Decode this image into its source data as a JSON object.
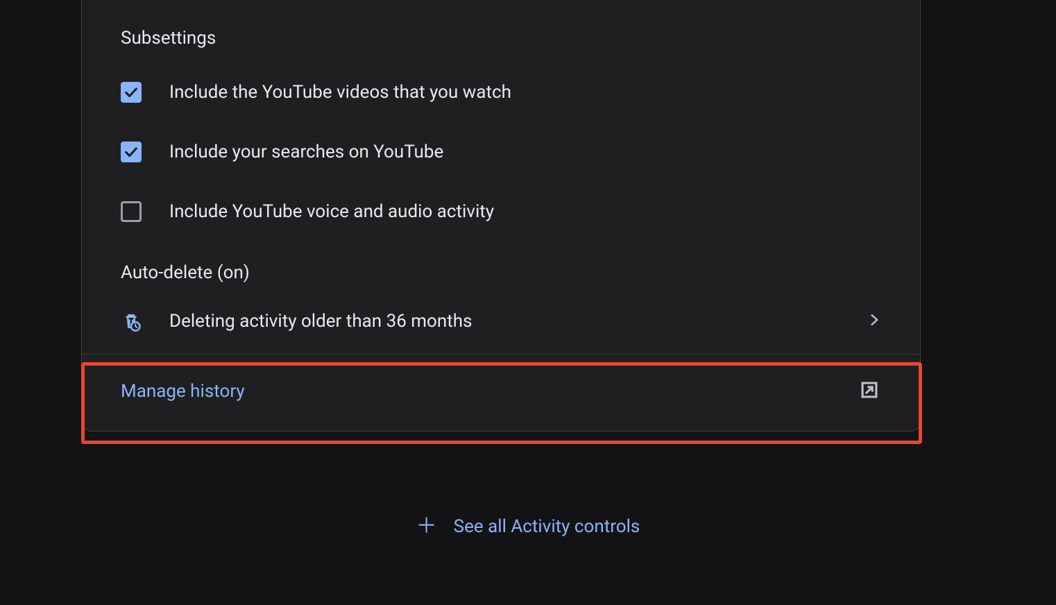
{
  "subsettings": {
    "title": "Subsettings",
    "items": [
      {
        "label": "Include the YouTube videos that you watch",
        "checked": true
      },
      {
        "label": "Include your searches on YouTube",
        "checked": true
      },
      {
        "label": "Include YouTube voice and audio activity",
        "checked": false
      }
    ]
  },
  "auto_delete": {
    "title": "Auto-delete (on)",
    "description": "Deleting activity older than 36 months"
  },
  "manage_history": {
    "label": "Manage history"
  },
  "footer": {
    "label": "See all Activity controls"
  }
}
